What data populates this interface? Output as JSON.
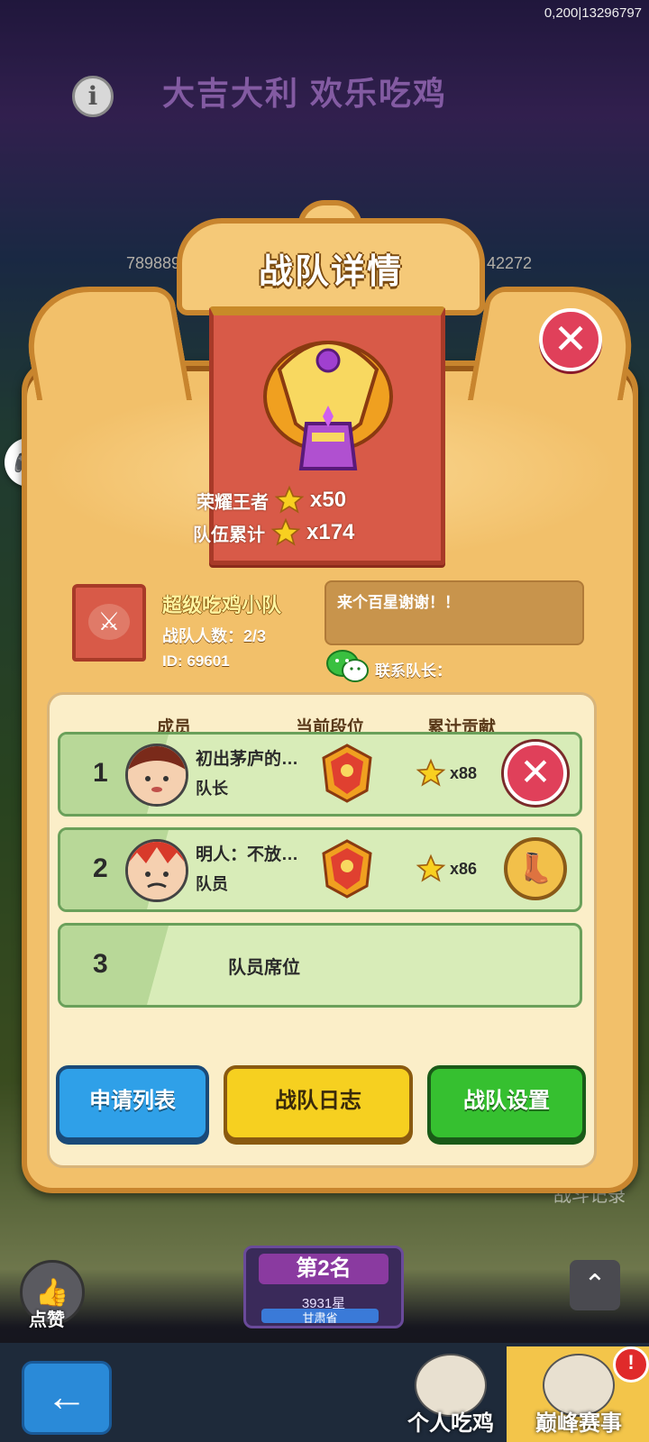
{
  "debug": "0,200|13296797",
  "background": {
    "title": "大吉大利 欢乐吃鸡",
    "score_left": "789889",
    "score_right": "42272",
    "like_label": "点赞",
    "rank_title": "第2名",
    "rank_stars": "3931星",
    "rank_sub": "甘肃省",
    "record_text": "战斗记录",
    "tabs": {
      "personal": "个人吃鸡",
      "peak": "巅峰赛事"
    },
    "alert": "!"
  },
  "modal": {
    "title": "战队详情",
    "honor_label": "荣耀王者",
    "honor_count": "x50",
    "total_label": "队伍累计",
    "total_count": "x174",
    "team_name": "超级吃鸡小队",
    "team_count": "战队人数：2/3",
    "team_id": "ID: 69601",
    "note": "来个百星谢谢！！",
    "contact": "联系队长："
  },
  "table": {
    "headers": [
      "成员",
      "当前段位",
      "累计贡献"
    ],
    "rows": [
      {
        "num": "1",
        "name": "初出茅庐的…",
        "role": "队长",
        "contrib": "x88"
      },
      {
        "num": "2",
        "name": "明人：不放…",
        "role": "队员",
        "contrib": "x86"
      },
      {
        "num": "3",
        "seat": "队员席位"
      }
    ]
  },
  "buttons": {
    "apply_list": "申请列表",
    "team_log": "战队日志",
    "team_settings": "战队设置"
  },
  "icons": {
    "close": "close-icon",
    "kick": "kick-icon",
    "boot": "boot-icon",
    "star": "star-icon",
    "wechat": "wechat-icon"
  }
}
